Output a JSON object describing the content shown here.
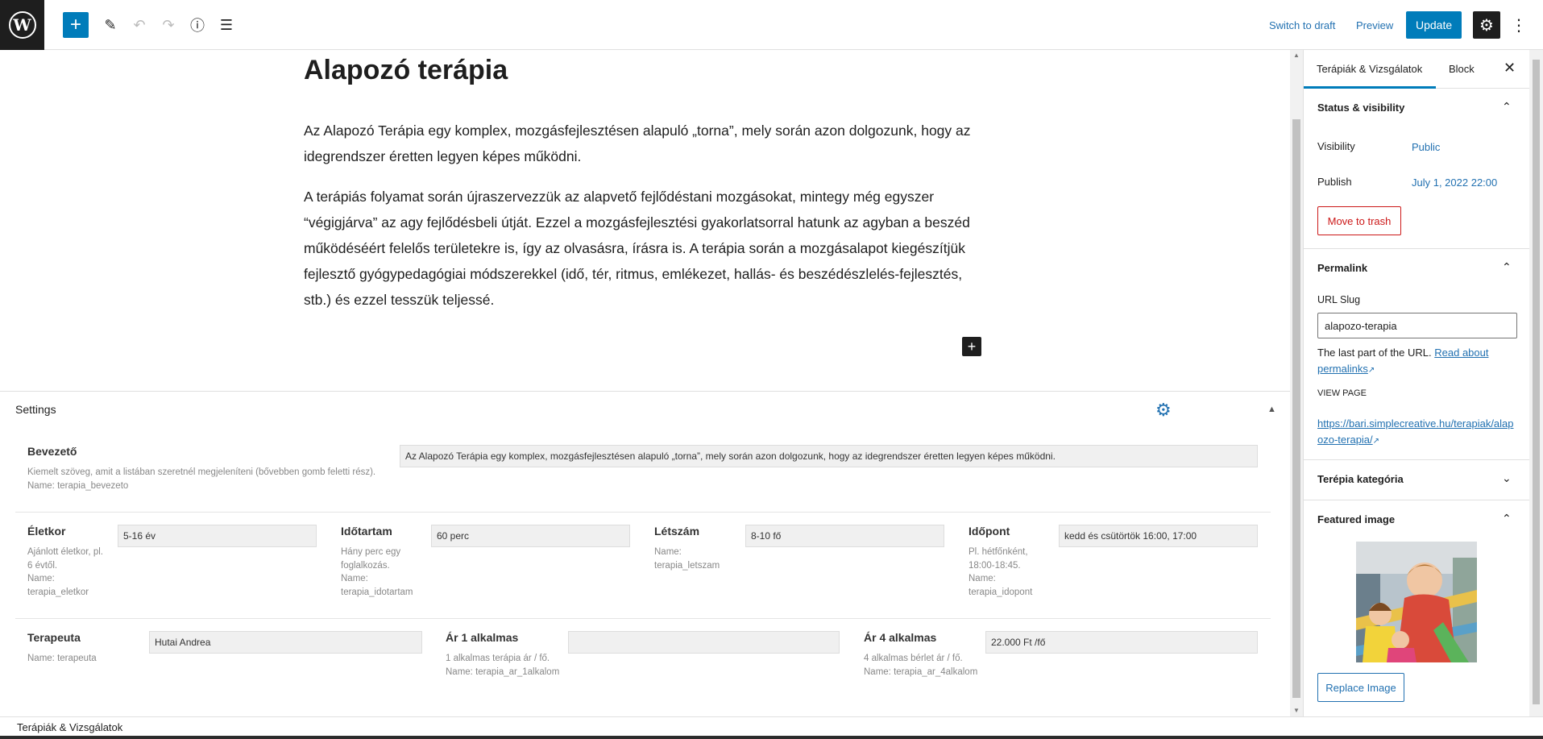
{
  "toolbar": {
    "logo_letter": "W",
    "add_icon": "+",
    "edit_icon": "✎",
    "undo_icon": "↶",
    "redo_icon": "↷",
    "info_icon": "ⓘ",
    "list_icon": "☰",
    "switch_to_draft": "Switch to draft",
    "preview": "Preview",
    "update": "Update",
    "gear_icon": "⚙",
    "options_icon": "⋮"
  },
  "post": {
    "title": "Alapozó terápia",
    "paragraphs": [
      "Az Alapozó Terápia egy komplex, mozgásfejlesztésen alapuló „torna”, mely során azon dolgozunk, hogy az idegrendszer éretten legyen képes működni.",
      "A terápiás folyamat során újraszervezzük az alapvető fejlődéstani mozgásokat, mintegy még egyszer “végigjárva” az agy fejlődésbeli útját. Ezzel a mozgásfejlesztési gyakorlatsorral hatunk az agyban a beszéd működéséért felelős területekre is, így az olvasásra, írásra is. A terápia során a mozgásalapot kiegészítjük fejlesztő gyógypedagógiai módszerekkel (idő, tér, ritmus, emlékezet, hallás- és beszédészlelés-fejlesztés, stb.) és ezzel tesszük teljessé."
    ],
    "inserter_icon": "+"
  },
  "settings": {
    "title": "Settings",
    "gear_icon": "⚙",
    "caret_icon": "▲",
    "bevezeto": {
      "label": "Bevezető",
      "desc1": "Kiemelt szöveg, amit a listában szeretnél megjeleníteni (bővebben gomb feletti rész).",
      "desc2": "Name: terapia_bevezeto",
      "value": "Az Alapozó Terápia egy komplex, mozgásfejlesztésen alapuló „torna”, mely során azon dolgozunk, hogy az idegrendszer éretten legyen képes működni."
    },
    "eletkor": {
      "label": "Életkor",
      "desc": [
        "Ajánlott életkor, pl.",
        "6 évtől.",
        "Name:",
        "terapia_eletkor"
      ],
      "value": "5-16 év"
    },
    "idotartam": {
      "label": "Időtartam",
      "desc": [
        "Hány perc egy",
        "foglalkozás.",
        "Name:",
        "terapia_idotartam"
      ],
      "value": "60 perc"
    },
    "letszam": {
      "label": "Létszám",
      "desc": [
        "Name:",
        "terapia_letszam"
      ],
      "value": "8-10 fő"
    },
    "idopont": {
      "label": "Időpont",
      "desc": [
        "Pl. hétfőnként,",
        "18:00-18:45.",
        "Name:",
        "terapia_idopont"
      ],
      "value": "kedd és csütörtök 16:00, 17:00"
    },
    "terapeuta": {
      "label": "Terapeuta",
      "desc": "Name: terapeuta",
      "value": "Hutai Andrea"
    },
    "ar1": {
      "label": "Ár 1 alkalmas",
      "desc": [
        "1 alkalmas terápia ár / fő.",
        "Name: terapia_ar_1alkalom"
      ],
      "value": ""
    },
    "ar4": {
      "label": "Ár 4 alkalmas",
      "desc": [
        "4 alkalmas bérlet ár / fő.",
        "Name: terapia_ar_4alkalom"
      ],
      "value": "22.000 Ft /fő"
    }
  },
  "sidebar": {
    "tab_post": "Terápiák & Vizsgálatok",
    "tab_block": "Block",
    "close_icon": "✕",
    "status": {
      "title": "Status & visibility",
      "chevron": "⌃",
      "visibility_label": "Visibility",
      "visibility_value": "Public",
      "publish_label": "Publish",
      "publish_value": "July 1, 2022 22:00",
      "trash": "Move to trash"
    },
    "permalink": {
      "title": "Permalink",
      "chevron": "⌃",
      "slug_label": "URL Slug",
      "slug_value": "alapozo-terapia",
      "help_text": "The last part of the URL.",
      "help_link_1": "Read about",
      "help_link_2": "permalinks",
      "view_page": "VIEW PAGE",
      "url_line_1": "https://bari.simplecreative.hu/terapiak/alap",
      "url_line_2": "ozo-terapia/",
      "external_icon": "↗"
    },
    "category": {
      "title": "Terépia kategória",
      "chevron": "⌄"
    },
    "featured": {
      "title": "Featured image",
      "chevron": "⌃",
      "replace": "Replace Image"
    }
  },
  "footer": {
    "breadcrumb": "Terápiák & Vizsgálatok"
  }
}
